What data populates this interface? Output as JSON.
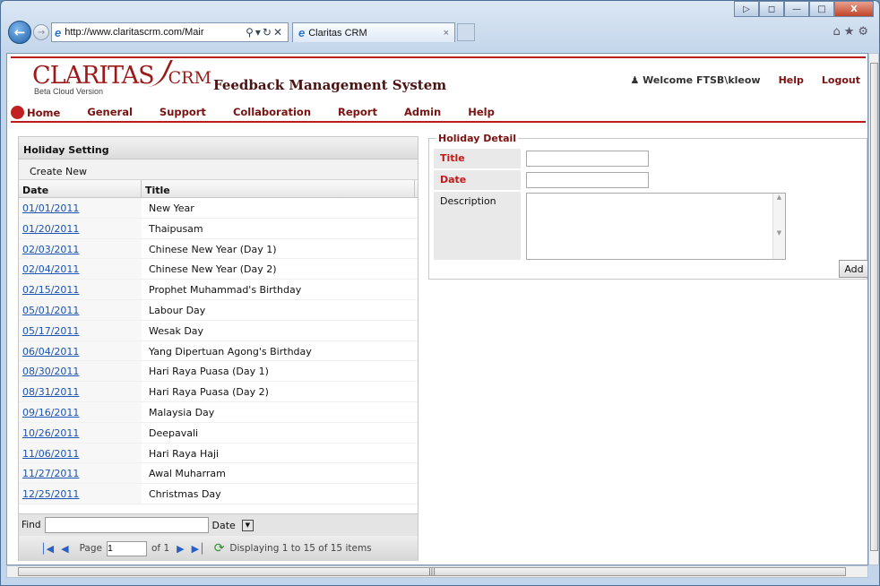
{
  "browser": {
    "url": "http://www.claritascrm.com/Mair",
    "tab_title": "Claritas CRM"
  },
  "header": {
    "logo_main": "CLARITAS",
    "logo_crm": "CRM",
    "logo_beta": "Beta Cloud Version",
    "system_name": "Feedback Management System",
    "welcome": "Welcome FTSB\\kleow",
    "help": "Help",
    "logout": "Logout"
  },
  "menu": [
    "Home",
    "General",
    "Support",
    "Collaboration",
    "Report",
    "Admin",
    "Help"
  ],
  "grid": {
    "title": "Holiday Setting",
    "create_new": "Create New",
    "col_date": "Date",
    "col_title": "Title",
    "rows": [
      {
        "date": "01/01/2011",
        "title": "New Year"
      },
      {
        "date": "01/20/2011",
        "title": "Thaipusam"
      },
      {
        "date": "02/03/2011",
        "title": "Chinese New Year (Day 1)"
      },
      {
        "date": "02/04/2011",
        "title": "Chinese New Year (Day 2)"
      },
      {
        "date": "02/15/2011",
        "title": "Prophet Muhammad's Birthday"
      },
      {
        "date": "05/01/2011",
        "title": "Labour Day"
      },
      {
        "date": "05/17/2011",
        "title": "Wesak Day"
      },
      {
        "date": "06/04/2011",
        "title": "Yang Dipertuan Agong's Birthday"
      },
      {
        "date": "08/30/2011",
        "title": "Hari Raya Puasa (Day 1)"
      },
      {
        "date": "08/31/2011",
        "title": "Hari Raya Puasa (Day 2)"
      },
      {
        "date": "09/16/2011",
        "title": "Malaysia Day"
      },
      {
        "date": "10/26/2011",
        "title": "Deepavali"
      },
      {
        "date": "11/06/2011",
        "title": "Hari Raya Haji"
      },
      {
        "date": "11/27/2011",
        "title": "Awal Muharram"
      },
      {
        "date": "12/25/2011",
        "title": "Christmas Day"
      }
    ],
    "find_label": "Find",
    "find_field": "Date",
    "page_label": "Page",
    "page_value": "1",
    "of_label": "of 1",
    "displaying": "Displaying 1 to 15 of 15 items"
  },
  "detail": {
    "legend": "Holiday Detail",
    "title_label": "Title",
    "date_label": "Date",
    "description_label": "Description",
    "add_button": "Add"
  }
}
